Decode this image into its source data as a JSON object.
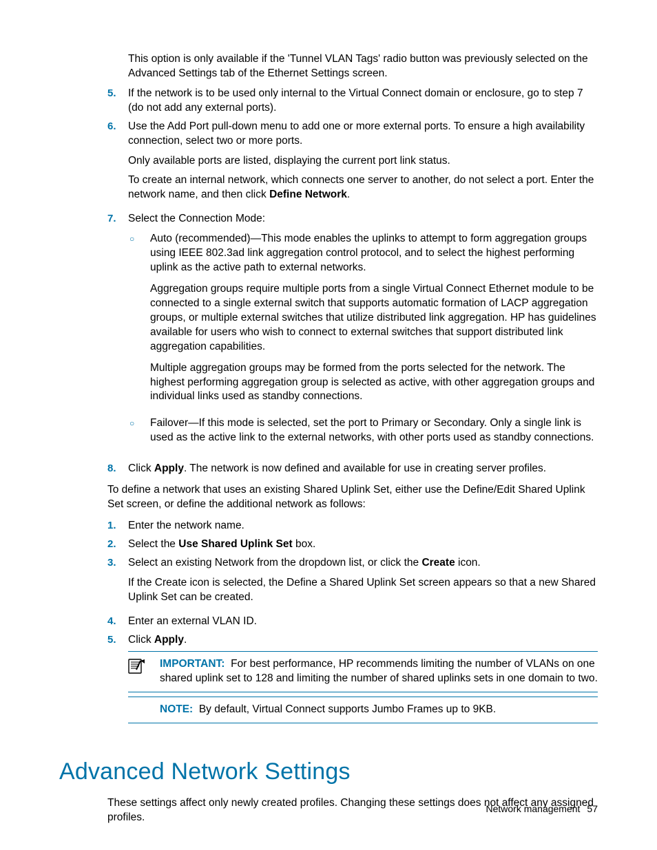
{
  "intro_para": "This option is only available if the 'Tunnel VLAN Tags' radio button was previously selected on the Advanced Settings tab of the Ethernet Settings screen.",
  "list1": {
    "i5": {
      "num": "5.",
      "text": "If the network is to be used only internal to the Virtual Connect domain or enclosure, go to step 7 (do not add any external ports)."
    },
    "i6": {
      "num": "6.",
      "p1": "Use the Add Port pull-down menu to add one or more external ports. To ensure a high availability connection, select two or more ports.",
      "p2": "Only available ports are listed, displaying the current port link status.",
      "p3a": "To create an internal network, which connects one server to another, do not select a port. Enter the network name, and then click ",
      "p3b": "Define Network",
      "p3c": "."
    },
    "i7": {
      "num": "7.",
      "lead": "Select the Connection Mode:",
      "a": {
        "p1": "Auto (recommended)—This mode enables the uplinks to attempt to form aggregation groups using IEEE 802.3ad link aggregation control protocol, and to select the highest performing uplink as the active path to external networks.",
        "p2": "Aggregation groups require multiple ports from a single Virtual Connect Ethernet module to be connected to a single external switch that supports automatic formation of LACP aggregation groups, or multiple external switches that utilize distributed link aggregation. HP has guidelines available for users who wish to connect to external switches that support distributed link aggregation capabilities.",
        "p3": "Multiple aggregation groups may be formed from the ports selected for the network. The highest performing aggregation group is selected as active, with other aggregation groups and individual links used as standby connections."
      },
      "b": {
        "p1": "Failover—If this mode is selected, set the port to Primary or Secondary. Only a single link is used as the active link to the external networks, with other ports used as standby connections."
      }
    },
    "i8": {
      "num": "8.",
      "a": "Click ",
      "b": "Apply",
      "c": ". The network is now defined and available for use in creating server profiles."
    }
  },
  "mid_para": "To define a network that uses an existing Shared Uplink Set, either use the Define/Edit Shared Uplink Set screen, or define the additional network as follows:",
  "list2": {
    "i1": {
      "num": "1.",
      "text": "Enter the network name."
    },
    "i2": {
      "num": "2.",
      "a": "Select the ",
      "b": "Use Shared Uplink Set",
      "c": " box."
    },
    "i3": {
      "num": "3.",
      "p1a": "Select an existing Network from the dropdown list, or click the ",
      "p1b": "Create",
      "p1c": " icon.",
      "p2": "If the Create icon is selected, the Define a Shared Uplink Set screen appears so that a new Shared Uplink Set can be created."
    },
    "i4": {
      "num": "4.",
      "text": "Enter an external VLAN ID."
    },
    "i5": {
      "num": "5.",
      "a": "Click ",
      "b": "Apply",
      "c": "."
    }
  },
  "important": {
    "label": "IMPORTANT:",
    "text": "For best performance, HP recommends limiting the number of VLANs on one shared uplink set to 128 and limiting the number of shared uplinks sets in one domain to two."
  },
  "note": {
    "label": "NOTE:",
    "text": "By default, Virtual Connect supports Jumbo Frames up to 9KB."
  },
  "section_heading": "Advanced Network Settings",
  "section_para": "These settings affect only newly created profiles. Changing these settings does not affect any assigned profiles.",
  "footer": {
    "label": "Network management",
    "page": "57"
  }
}
